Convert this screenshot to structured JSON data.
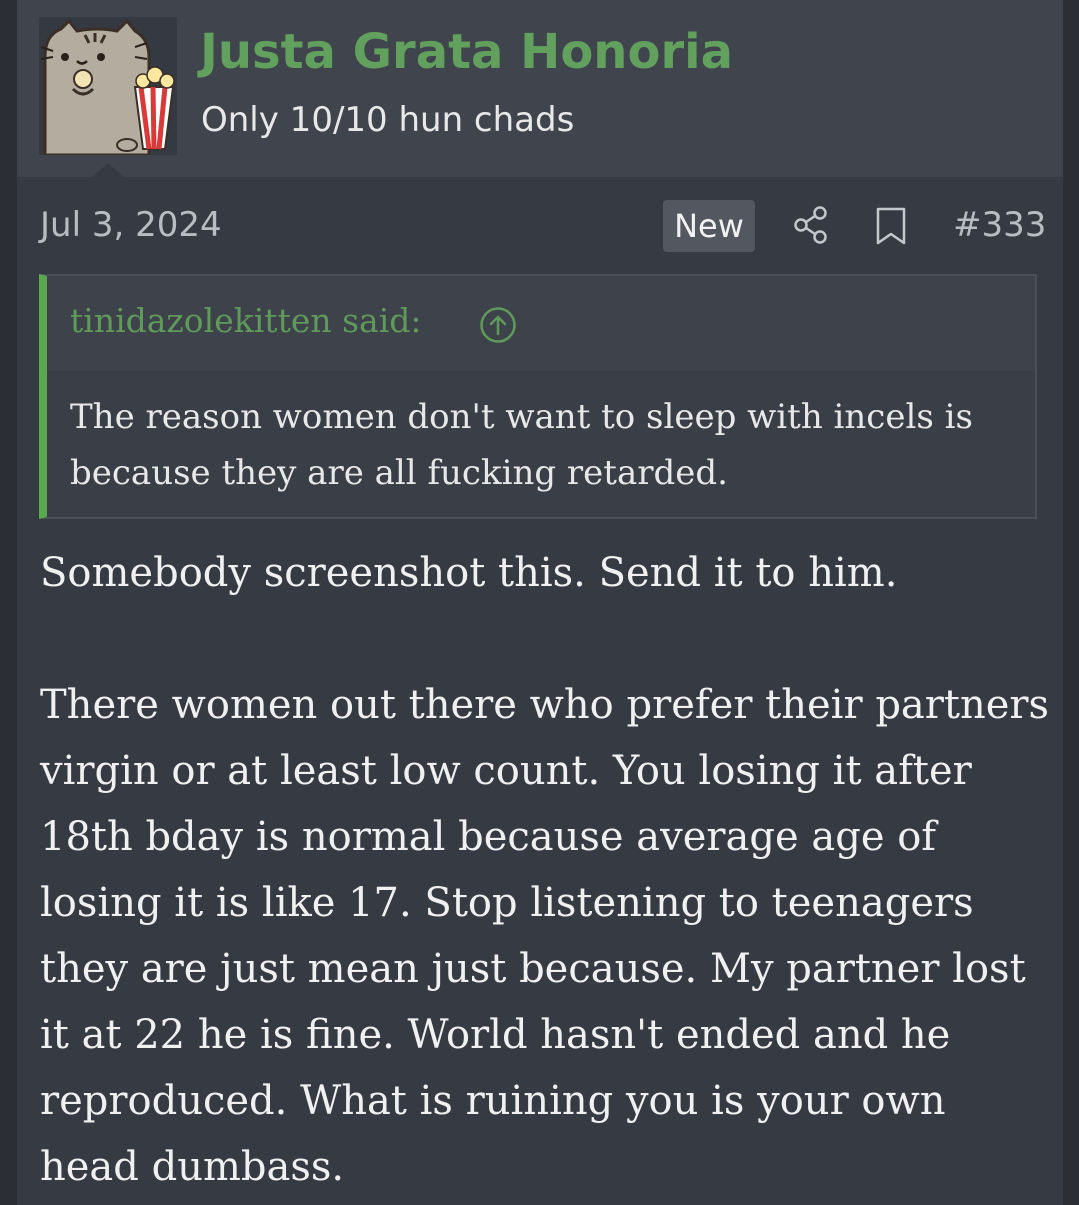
{
  "user": {
    "name": "Justa Grata Honoria",
    "title": "Only 10/10 hun chads",
    "avatar_icon": "pusheen-popcorn-avatar",
    "name_color": "#62a05e"
  },
  "post": {
    "date": "Jul 3, 2024",
    "badge": "New",
    "number": "#333",
    "share_icon": "share-icon",
    "bookmark_icon": "bookmark-icon"
  },
  "quote": {
    "attribution": "tinidazolekitten said:",
    "jump_icon": "arrow-up-circle-icon",
    "text": "The reason women don't want to sleep with incels is because they are all fucking retarded.",
    "accent_color": "#5aa84f"
  },
  "message": {
    "paragraphs": [
      "Somebody screenshot this. Send it to him.",
      "There women out there who prefer their partners virgin or at least low count. You losing it after 18th bday is normal because average age of losing it is like 17. Stop listening to teenagers they are just mean just because. My partner lost it at 22 he is fine. World hasn't ended and he reproduced. What is ruining you is your own head dumbass."
    ]
  }
}
